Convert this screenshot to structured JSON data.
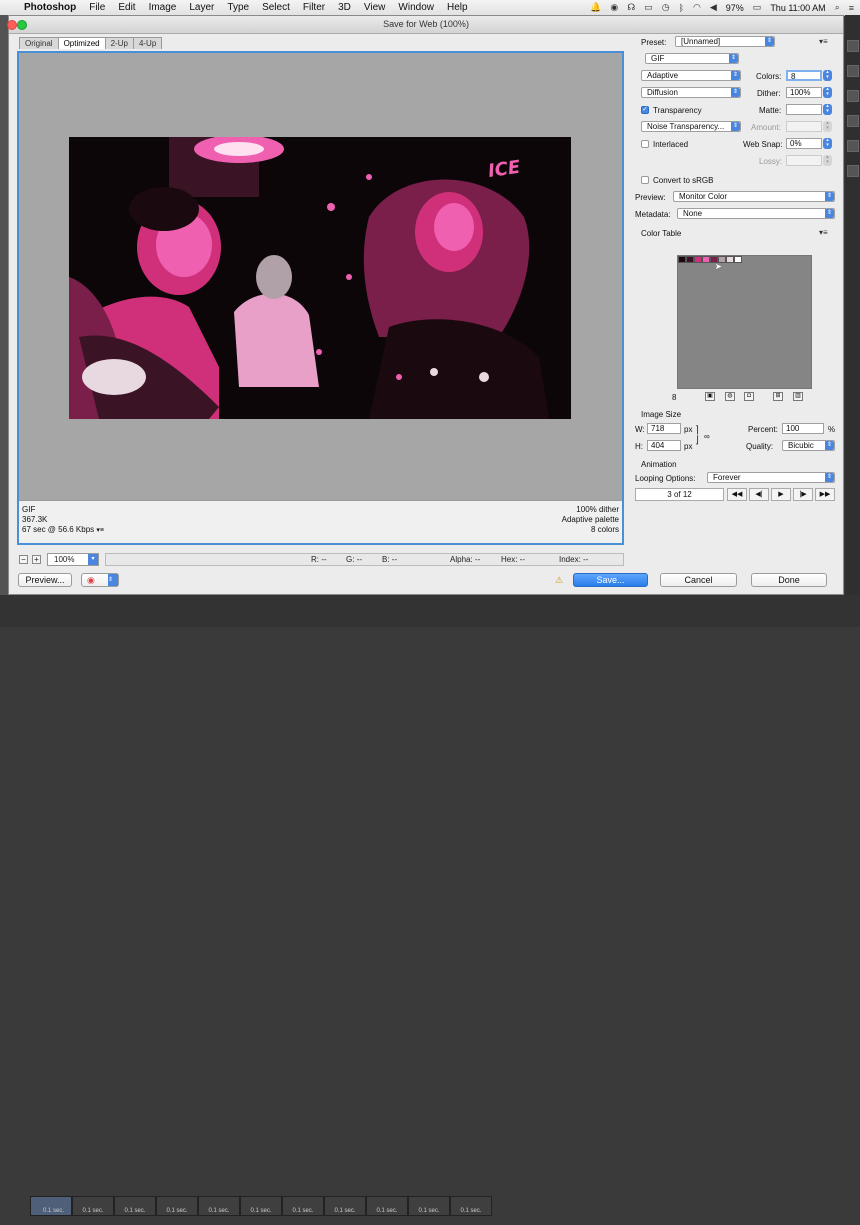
{
  "menubar": {
    "apple": "",
    "app_name": "Photoshop",
    "items": [
      "File",
      "Edit",
      "Image",
      "Layer",
      "Type",
      "Select",
      "Filter",
      "3D",
      "View",
      "Window",
      "Help"
    ],
    "battery": "97%",
    "clock": "Thu 11:00 AM"
  },
  "dialog": {
    "title": "Save for Web (100%)",
    "tabs": [
      "Original",
      "Optimized",
      "2-Up",
      "4-Up"
    ],
    "active_tab": "Optimized",
    "info_left": [
      "GIF",
      "367.3K",
      "67 sec @ 56.6 Kbps"
    ],
    "info_right": [
      "100% dither",
      "Adaptive palette",
      "8 colors"
    ],
    "zoom": "100%",
    "readout": {
      "r": "R: --",
      "g": "G: --",
      "b": "B: --",
      "alpha": "Alpha: --",
      "hex": "Hex: --",
      "index": "Index: --"
    },
    "preview_button": "Preview...",
    "save_button": "Save...",
    "cancel_button": "Cancel",
    "done_button": "Done"
  },
  "settings": {
    "preset_label": "Preset:",
    "preset_value": "[Unnamed]",
    "format": "GIF",
    "reduction": "Adaptive",
    "colors_label": "Colors:",
    "colors_value": "8",
    "dither_algo": "Diffusion",
    "dither_label": "Dither:",
    "dither_value": "100%",
    "transparency_label": "Transparency",
    "transparency_checked": true,
    "matte_label": "Matte:",
    "transparency_dither": "Noise Transparency...",
    "amount_label": "Amount:",
    "interlaced_label": "Interlaced",
    "interlaced_checked": false,
    "websnap_label": "Web Snap:",
    "websnap_value": "0%",
    "lossy_label": "Lossy:",
    "srgb_label": "Convert to sRGB",
    "srgb_checked": false,
    "preview_label": "Preview:",
    "preview_value": "Monitor Color",
    "metadata_label": "Metadata:",
    "metadata_value": "None"
  },
  "color_table": {
    "label": "Color Table",
    "count": "8",
    "swatches": [
      "#1a0a10",
      "#3a1424",
      "#d0307a",
      "#f060b0",
      "#7a1e4a",
      "#b0a0a8",
      "#e8d8e0",
      "#ffffff"
    ]
  },
  "image_size": {
    "label": "Image Size",
    "w_label": "W:",
    "w_value": "718",
    "h_label": "H:",
    "h_value": "404",
    "unit": "px",
    "percent_label": "Percent:",
    "percent_value": "100",
    "percent_unit": "%",
    "quality_label": "Quality:",
    "quality_value": "Bicubic"
  },
  "animation": {
    "label": "Animation",
    "looping_label": "Looping Options:",
    "looping_value": "Forever",
    "frame_counter": "3 of 12"
  },
  "timeline": {
    "frame_delays": [
      "0.1 sec.",
      "0.1 sec.",
      "0.1 sec.",
      "0.1 sec.",
      "0.1 sec.",
      "0.1 sec.",
      "0.1 sec.",
      "0.1 sec.",
      "0.1 sec.",
      "0.1 sec.",
      "0.1 sec.",
      "0.1 sec."
    ]
  }
}
